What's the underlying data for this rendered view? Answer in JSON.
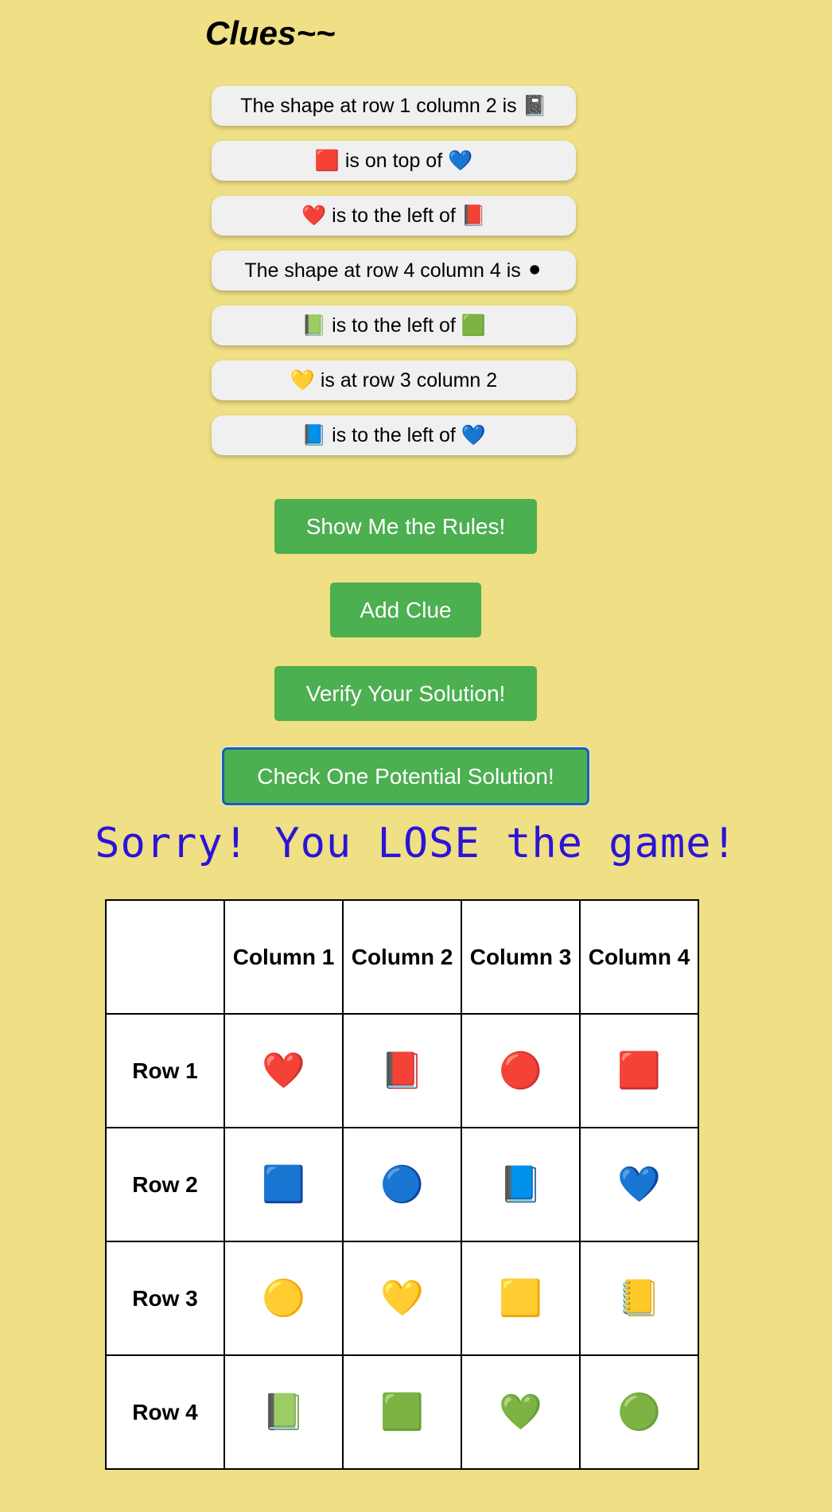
{
  "title": "Clues~~",
  "clues": [
    "The shape at row 1 column 2 is 📓",
    "🟥 is on top of 💙",
    "❤️ is to the left of 📕",
    "The shape at row 4 column 4 is ⚫",
    "📗 is to the left of 🟩",
    "💛 is at row 3 column 2",
    "📘 is to the left of 💙"
  ],
  "buttons": {
    "rules": "Show Me the Rules!",
    "add": "Add Clue",
    "verify": "Verify Your Solution!",
    "check": "Check One Potential Solution!"
  },
  "result_message": "Sorry! You LOSE the game!",
  "grid": {
    "corner": "",
    "columns": [
      "Column 1",
      "Column 2",
      "Column 3",
      "Column 4"
    ],
    "rows": [
      {
        "label": "Row 1",
        "cells": [
          "❤️",
          "📕",
          "🔴",
          "🟥"
        ]
      },
      {
        "label": "Row 2",
        "cells": [
          "🟦",
          "🔵",
          "📘",
          "💙"
        ]
      },
      {
        "label": "Row 3",
        "cells": [
          "🟡",
          "💛",
          "🟨",
          "📒"
        ]
      },
      {
        "label": "Row 4",
        "cells": [
          "📗",
          "🟩",
          "💚",
          "🟢"
        ]
      }
    ]
  },
  "colors": {
    "background": "#efdf85",
    "button": "#4caf50",
    "result_text": "#2a14d8"
  }
}
